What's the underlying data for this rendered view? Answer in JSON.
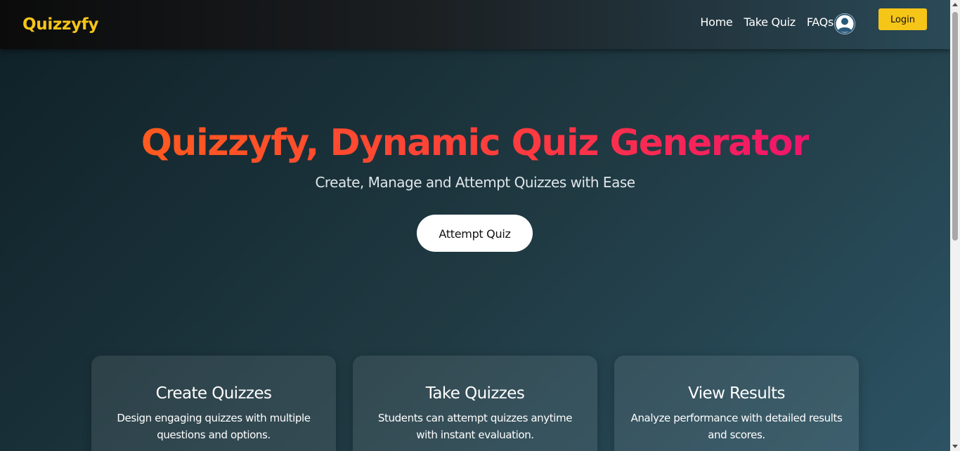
{
  "navbar": {
    "brand": "Quizzyfy",
    "links": [
      {
        "label": "Home"
      },
      {
        "label": "Take Quiz"
      },
      {
        "label": "FAQs"
      }
    ],
    "avatar_icon": "user-avatar-icon",
    "login_label": "Login"
  },
  "hero": {
    "title": "Quizzyfy, Dynamic Quiz Generator",
    "subtitle": "Create, Manage and Attempt Quizzes with Ease",
    "cta_label": "Attempt Quiz"
  },
  "features": [
    {
      "title": "Create Quizzes",
      "description": "Design engaging quizzes with multiple questions and options."
    },
    {
      "title": "Take Quizzes",
      "description": "Students can attempt quizzes anytime with instant evaluation."
    },
    {
      "title": "View Results",
      "description": "Analyze performance with detailed results and scores."
    }
  ],
  "colors": {
    "brand": "#f5c518",
    "gradient_start": "#ff5a1f",
    "gradient_end": "#f0146c",
    "background": "#203a43"
  }
}
